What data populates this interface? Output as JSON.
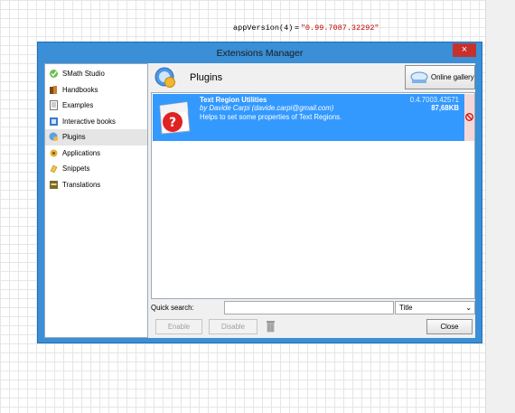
{
  "worksheet": {
    "expression_prefix": "appVersion(4) = ",
    "expression_value": "\"0.99.7087.32292\""
  },
  "window": {
    "title": "Extensions Manager",
    "close_glyph": "×"
  },
  "sidebar": {
    "items": [
      {
        "label": "SMath Studio",
        "icon": "smath-logo-icon"
      },
      {
        "label": "Handbooks",
        "icon": "books-icon"
      },
      {
        "label": "Examples",
        "icon": "document-icon"
      },
      {
        "label": "Interactive books",
        "icon": "interactive-book-icon"
      },
      {
        "label": "Plugins",
        "icon": "plugin-icon",
        "selected": true
      },
      {
        "label": "Applications",
        "icon": "applications-icon"
      },
      {
        "label": "Snippets",
        "icon": "snippets-icon"
      },
      {
        "label": "Translations",
        "icon": "translations-icon"
      }
    ]
  },
  "header": {
    "title": "Plugins",
    "gallery_label": "Online gallery"
  },
  "plugins": [
    {
      "name": "Text Region Utilities",
      "author": "by Davide Carpi (davide.carpi@gmail.com)",
      "description": "Helps to set some properties of Text Regions.",
      "version": "0.4.7003.42571",
      "size": "87,68KB"
    }
  ],
  "search": {
    "label": "Quick search:",
    "value": "",
    "filter_selected": "Title"
  },
  "buttons": {
    "enable": "Enable",
    "disable": "Disable",
    "close": "Close"
  },
  "colors": {
    "window_frame": "#3a8fd6",
    "selection": "#3399ff",
    "close_button": "#c7312b"
  }
}
